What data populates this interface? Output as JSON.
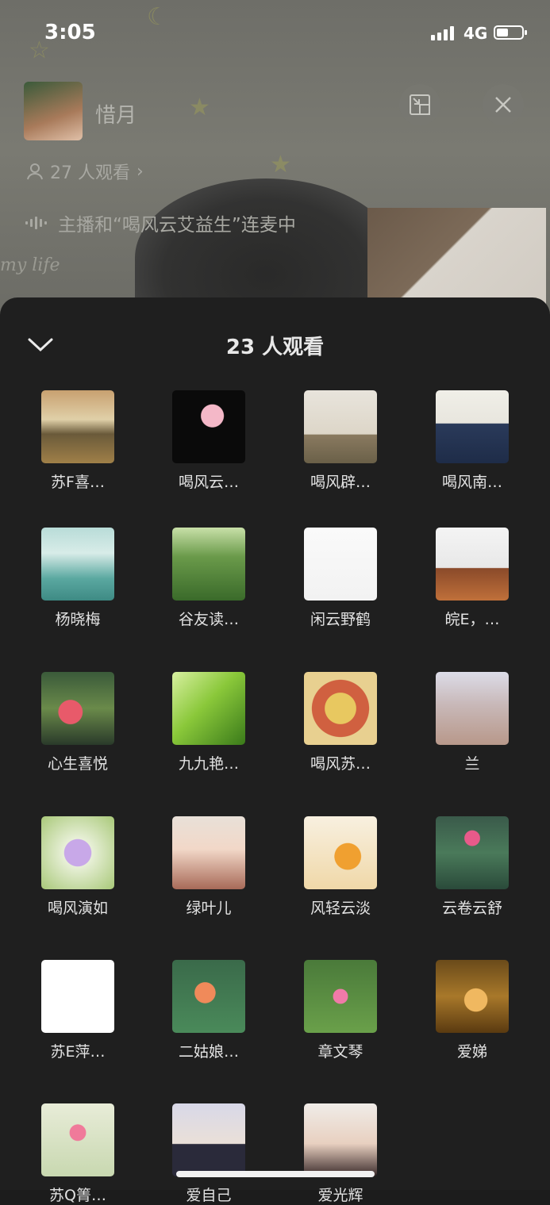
{
  "status_bar": {
    "time": "3:05",
    "network": "4G"
  },
  "host": {
    "name": "惜月"
  },
  "viewers_text": "27 人观看",
  "mic_status": "主播和“喝风云艾益生”连麦中",
  "background_text": "my life",
  "sheet": {
    "title": "23 人观看"
  },
  "audience": [
    {
      "name": "苏F喜…",
      "bg": "linear-gradient(180deg,#c8a070 0%,#e0d0a8 40%,#6a5a3a 60%,#a08048 100%)"
    },
    {
      "name": "喝风云…",
      "bg": "radial-gradient(circle at 55% 35%,#f4b8c8 0 18%,#0a0a0a 19%),linear-gradient(#000,#000)"
    },
    {
      "name": "喝风辟…",
      "bg": "linear-gradient(180deg,#e8e4dc 0%,#ddd6c8 60%,#8a7a60 61%,#6a6048 100%)"
    },
    {
      "name": "喝风南…",
      "bg": "linear-gradient(180deg,#f0efe8 0%,#e8e6de 45%,#2a3a5a 46%,#1e2c48 100%)"
    },
    {
      "name": "杨晓梅",
      "bg": "linear-gradient(180deg,#b8dcd8 0%,#d8ece8 35%,#5aa8a0 70%,#3e8a84 100%)"
    },
    {
      "name": "谷友读…",
      "bg": "linear-gradient(180deg,#c8e0a8 0%,#6a9a4a 40%,#3a6a2a 100%)"
    },
    {
      "name": "闲云野鹤",
      "bg": "linear-gradient(180deg,#fafafa 0%,#f2f2f2 100%)"
    },
    {
      "name": "皖E，…",
      "bg": "linear-gradient(180deg,#f4f4f4 0%,#e8e8e8 55%,#8a4a2a 56%,#c0703a 100%)"
    },
    {
      "name": "心生喜悦",
      "bg": "radial-gradient(circle at 40% 55%,#e85a6a 0 20%,transparent 21%),linear-gradient(180deg,#3a5a3a 0%,#6a8a4a 50%,#2a3a2a 100%)"
    },
    {
      "name": "九九艳…",
      "bg": "linear-gradient(135deg,#d8f0a0 0%,#8ac83a 45%,#3a7a1a 100%)"
    },
    {
      "name": "喝风苏…",
      "bg": "radial-gradient(circle at 50% 50%,#e8c860 0 30%,#d06040 31% 55%,#e8d090 56%)"
    },
    {
      "name": "兰",
      "bg": "linear-gradient(180deg,#dcdce8 0%,#c8b8b8 45%,#b8988a 100%)"
    },
    {
      "name": "喝风演如",
      "bg": "radial-gradient(circle at 50% 50%,#c8a8e8 0 26%,#e8f0d8 27%,#a8c878 100%)"
    },
    {
      "name": "绿叶儿",
      "bg": "linear-gradient(180deg,#e8e0d8 0%,#f2d8c8 45%,#a86a58 100%)"
    },
    {
      "name": "风轻云淡",
      "bg": "radial-gradient(circle at 60% 55%,#f0a030 0 22%,transparent 23%),linear-gradient(180deg,#f8f0e0 0%,#f0d8a8 100%)"
    },
    {
      "name": "云卷云舒",
      "bg": "radial-gradient(circle at 50% 30%,#e85a8a 0 12%,transparent 13%),linear-gradient(180deg,#3a5a4a 0%,#4a7a5a 50%,#2a4a3a 100%)"
    },
    {
      "name": "苏E萍…",
      "bg": "linear-gradient(180deg,#ffffff 0%,#ffffff 100%)"
    },
    {
      "name": "二姑娘…",
      "bg": "radial-gradient(circle at 45% 45%,#f08a5a 0 18%,transparent 19%),linear-gradient(180deg,#3a6a4a 0%,#4a8a5a 100%)"
    },
    {
      "name": "章文琴",
      "bg": "radial-gradient(circle at 50% 50%,#f07aa8 0 14%,transparent 15%),linear-gradient(180deg,#4a7a3a 0%,#6aa04a 100%)"
    },
    {
      "name": "爱娣",
      "bg": "radial-gradient(circle at 55% 55%,#f0b860 0 20%,transparent 21%),linear-gradient(180deg,#6a4a1a 0%,#a8782a 50%,#5a3a10 100%)"
    },
    {
      "name": "苏Q箐…",
      "bg": "radial-gradient(circle at 50% 40%,#f07a9a 0 14%,transparent 15%),linear-gradient(180deg,#e8ecd8 0%,#c8d8b0 100%)"
    },
    {
      "name": "爱自己",
      "bg": "linear-gradient(180deg,#d8d8e8 0%,#eae0d8 55%,#2a2a3a 56%,#2a2a3a 100%)"
    },
    {
      "name": "爱光辉",
      "bg": "linear-gradient(180deg,#f0ece8 0%,#e8d0c0 55%,#3a2a2a 100%)"
    }
  ]
}
